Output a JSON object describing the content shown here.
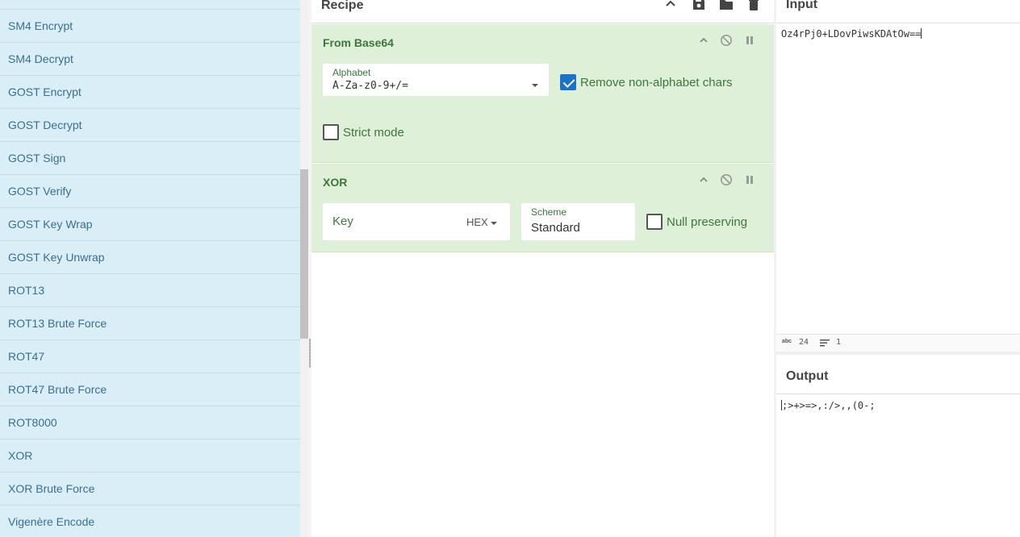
{
  "operations": [
    "SM4 Encrypt",
    "SM4 Decrypt",
    "GOST Encrypt",
    "GOST Decrypt",
    "GOST Sign",
    "GOST Verify",
    "GOST Key Wrap",
    "GOST Key Unwrap",
    "ROT13",
    "ROT13 Brute Force",
    "ROT47",
    "ROT47 Brute Force",
    "ROT8000",
    "XOR",
    "XOR Brute Force",
    "Vigenère Encode"
  ],
  "recipe": {
    "title": "Recipe",
    "header_icons": [
      "chevron-up-icon",
      "save-icon",
      "folder-icon",
      "trash-icon"
    ],
    "ops": [
      {
        "title": "From Base64",
        "alphabet_label": "Alphabet",
        "alphabet_value": "A-Za-z0-9+/=",
        "remove_nonalpha_label": "Remove non-alphabet chars",
        "remove_nonalpha_checked": true,
        "strict_label": "Strict mode",
        "strict_checked": false
      },
      {
        "title": "XOR",
        "key_placeholder": "Key",
        "key_format": "HEX",
        "scheme_label": "Scheme",
        "scheme_value": "Standard",
        "null_label": "Null preserving",
        "null_checked": false
      }
    ]
  },
  "input": {
    "title": "Input",
    "text": "Oz4rPj0+LDovPiwsKDAtOw==",
    "stats_chars_icon": "abc",
    "stats_chars": "24",
    "stats_lines": "1"
  },
  "output": {
    "title": "Output",
    "text": ";>+>=>,:/>,,(0-;"
  },
  "colors": {
    "sidebar_bg": "#d9eef7",
    "op_bg": "#dff0d8",
    "op_title": "#3c763d",
    "checkbox_checked": "#1a73c8"
  }
}
